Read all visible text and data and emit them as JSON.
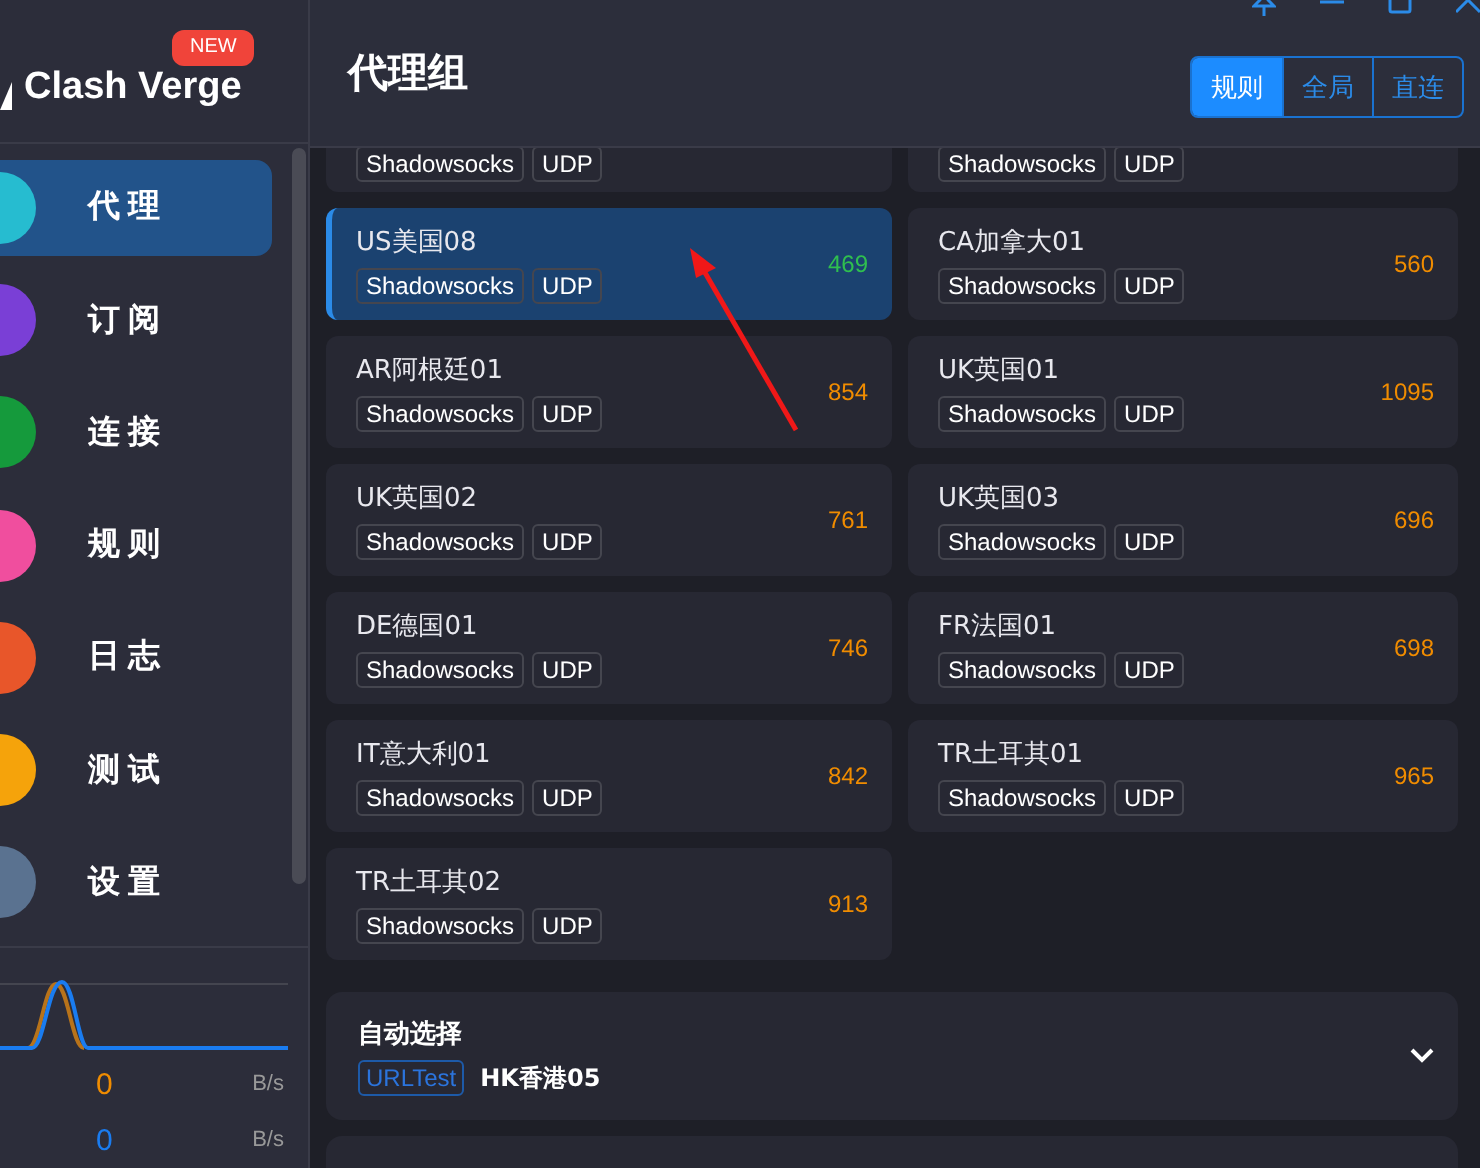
{
  "app": {
    "name": "Clash Verge",
    "badge": "NEW"
  },
  "nav": [
    {
      "label": "代理",
      "selected": true,
      "color": "#26bcd0"
    },
    {
      "label": "订阅",
      "selected": false,
      "color": "#7a3fd6"
    },
    {
      "label": "连接",
      "selected": false,
      "color": "#159a3c"
    },
    {
      "label": "规则",
      "selected": false,
      "color": "#f04e9e"
    },
    {
      "label": "日志",
      "selected": false,
      "color": "#e8562a"
    },
    {
      "label": "测试",
      "selected": false,
      "color": "#f5a30b"
    },
    {
      "label": "设置",
      "selected": false,
      "color": "#5a7290"
    }
  ],
  "traffic": [
    {
      "value": "0",
      "unit": "B/s",
      "color": "#f08c00"
    },
    {
      "value": "0",
      "unit": "B/s",
      "color": "#1a7cf0"
    }
  ],
  "header": {
    "title": "代理组",
    "modes": [
      {
        "label": "规则",
        "selected": true
      },
      {
        "label": "全局",
        "selected": false
      },
      {
        "label": "直连",
        "selected": false
      }
    ]
  },
  "proxies": [
    {
      "kind": "partial",
      "tags": [
        "Shadowsocks",
        "UDP"
      ],
      "selected": false
    },
    {
      "kind": "partial",
      "tags": [
        "Shadowsocks",
        "UDP"
      ],
      "selected": false
    },
    {
      "kind": "full",
      "name": "US美国08",
      "tags": [
        "Shadowsocks",
        "UDP"
      ],
      "delay": "469",
      "color": "#2fbf4f",
      "selected": true
    },
    {
      "kind": "full",
      "name": "CA加拿大01",
      "tags": [
        "Shadowsocks",
        "UDP"
      ],
      "delay": "560",
      "color": "#f08c00",
      "selected": false
    },
    {
      "kind": "full",
      "name": "AR阿根廷01",
      "tags": [
        "Shadowsocks",
        "UDP"
      ],
      "delay": "854",
      "color": "#f08c00",
      "selected": false
    },
    {
      "kind": "full",
      "name": "UK英国01",
      "tags": [
        "Shadowsocks",
        "UDP"
      ],
      "delay": "1095",
      "color": "#f08c00",
      "selected": false
    },
    {
      "kind": "full",
      "name": "UK英国02",
      "tags": [
        "Shadowsocks",
        "UDP"
      ],
      "delay": "761",
      "color": "#f08c00",
      "selected": false
    },
    {
      "kind": "full",
      "name": "UK英国03",
      "tags": [
        "Shadowsocks",
        "UDP"
      ],
      "delay": "696",
      "color": "#f08c00",
      "selected": false
    },
    {
      "kind": "full",
      "name": "DE德国01",
      "tags": [
        "Shadowsocks",
        "UDP"
      ],
      "delay": "746",
      "color": "#f08c00",
      "selected": false
    },
    {
      "kind": "full",
      "name": "FR法国01",
      "tags": [
        "Shadowsocks",
        "UDP"
      ],
      "delay": "698",
      "color": "#f08c00",
      "selected": false
    },
    {
      "kind": "full",
      "name": "IT意大利01",
      "tags": [
        "Shadowsocks",
        "UDP"
      ],
      "delay": "842",
      "color": "#f08c00",
      "selected": false
    },
    {
      "kind": "full",
      "name": "TR土耳其01",
      "tags": [
        "Shadowsocks",
        "UDP"
      ],
      "delay": "965",
      "color": "#f08c00",
      "selected": false
    },
    {
      "kind": "full",
      "name": "TR土耳其02",
      "tags": [
        "Shadowsocks",
        "UDP"
      ],
      "delay": "913",
      "color": "#f08c00",
      "selected": false
    }
  ],
  "groups": [
    {
      "kind": "full",
      "name": "自动选择",
      "type": "URLTest",
      "current": "HK香港05",
      "expanded": false
    },
    {
      "kind": "partial"
    }
  ]
}
